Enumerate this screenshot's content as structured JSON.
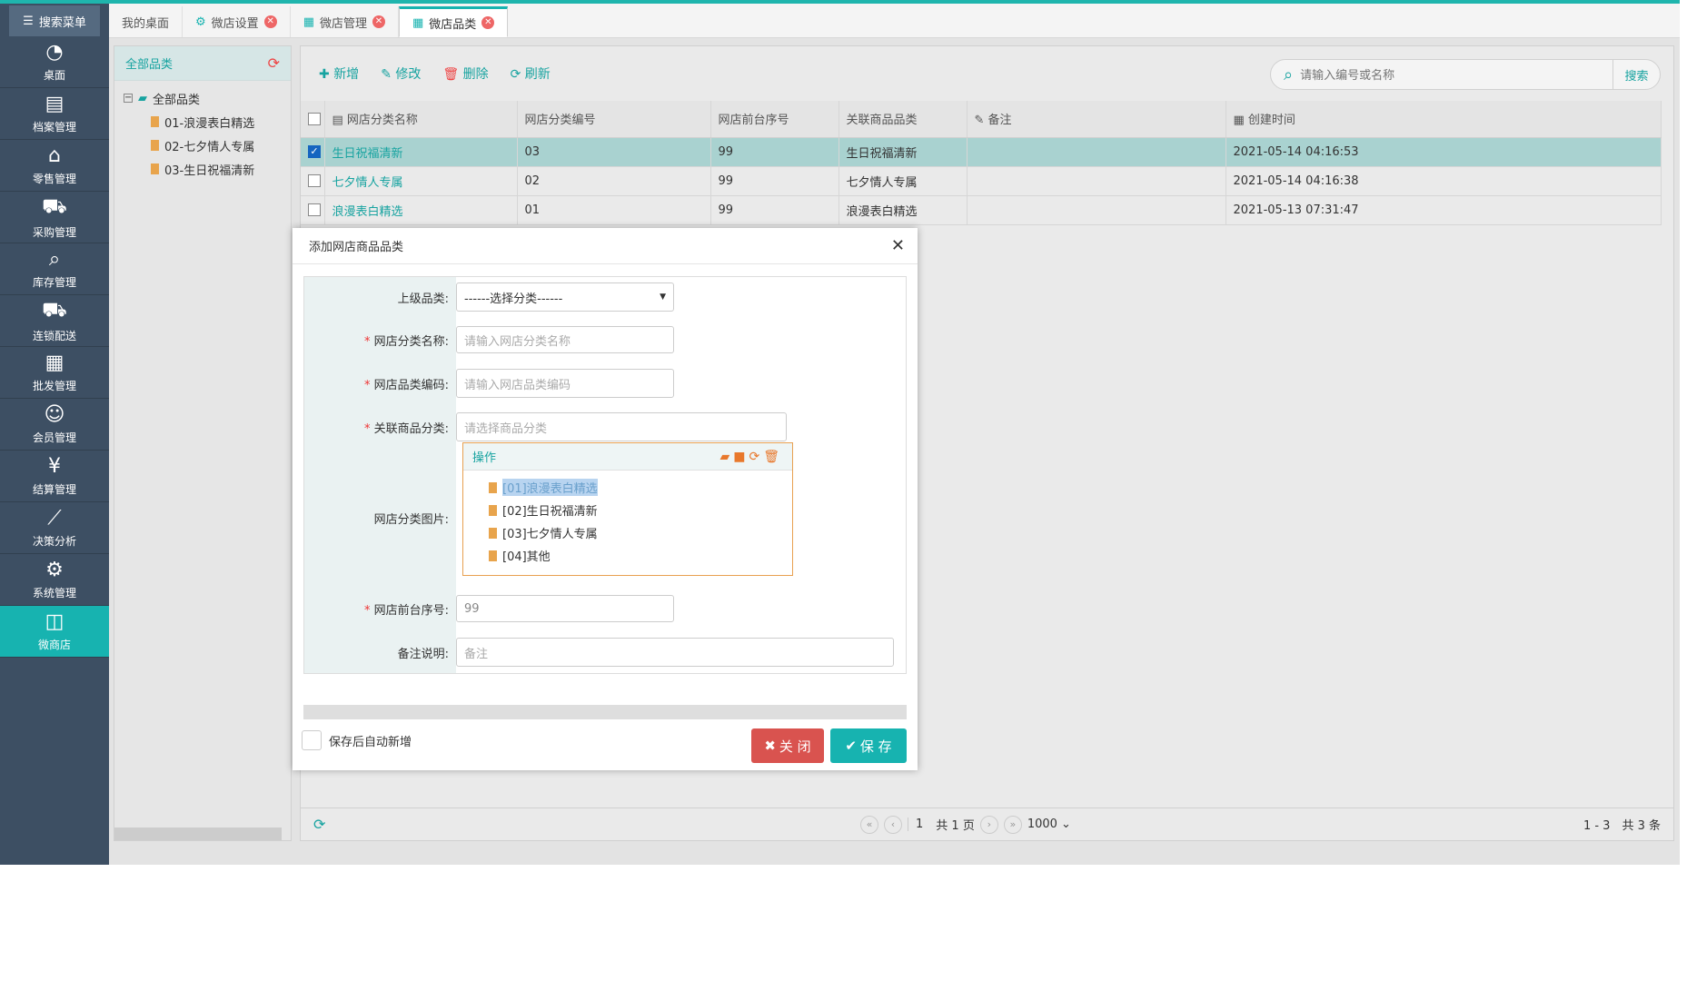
{
  "sidebar": {
    "search_label": "搜索菜单",
    "items": [
      {
        "label": "桌面",
        "icon": "dashboard-icon"
      },
      {
        "label": "档案管理",
        "icon": "archive-icon"
      },
      {
        "label": "零售管理",
        "icon": "store-icon"
      },
      {
        "label": "采购管理",
        "icon": "cart-icon"
      },
      {
        "label": "库存管理",
        "icon": "inventory-icon"
      },
      {
        "label": "连锁配送",
        "icon": "truck-icon"
      },
      {
        "label": "批发管理",
        "icon": "wholesale-icon"
      },
      {
        "label": "会员管理",
        "icon": "member-icon"
      },
      {
        "label": "结算管理",
        "icon": "settlement-icon"
      },
      {
        "label": "决策分析",
        "icon": "analysis-icon"
      },
      {
        "label": "系统管理",
        "icon": "gear-icon"
      },
      {
        "label": "微商店",
        "icon": "shop-bag-icon"
      }
    ]
  },
  "tabs": [
    {
      "label": "我的桌面"
    },
    {
      "label": "微店设置"
    },
    {
      "label": "微店管理"
    },
    {
      "label": "微店品类"
    }
  ],
  "left_panel": {
    "title": "全部品类",
    "root": "全部品类",
    "children": [
      "01-浪漫表白精选",
      "02-七夕情人专属",
      "03-生日祝福清新"
    ]
  },
  "toolbar": {
    "add": "新增",
    "edit": "修改",
    "delete": "删除",
    "refresh": "刷新",
    "search_placeholder": "请输入编号或名称",
    "search_btn": "搜索"
  },
  "table": {
    "headers": [
      "网店分类名称",
      "网店分类编号",
      "网店前台序号",
      "关联商品品类",
      "备注",
      "创建时间"
    ],
    "rows": [
      {
        "name": "生日祝福清新",
        "code": "03",
        "seq": "99",
        "cat": "生日祝福清新",
        "note": "",
        "time": "2021-05-14 04:16:53"
      },
      {
        "name": "七夕情人专属",
        "code": "02",
        "seq": "99",
        "cat": "七夕情人专属",
        "note": "",
        "time": "2021-05-14 04:16:38"
      },
      {
        "name": "浪漫表白精选",
        "code": "01",
        "seq": "99",
        "cat": "浪漫表白精选",
        "note": "",
        "time": "2021-05-13 07:31:47"
      }
    ]
  },
  "pager": {
    "page": "1",
    "total_pages": "共 1 页",
    "page_size": "1000",
    "summary": "1 - 3　共 3 条"
  },
  "dialog": {
    "title": "添加网店商品品类",
    "parent_label": "上级品类:",
    "parent_value": "------选择分类------",
    "name_label": "网店分类名称:",
    "name_placeholder": "请输入网店分类名称",
    "code_label": "网店品类编码:",
    "code_placeholder": "请输入网店品类编码",
    "cat_label": "关联商品分类:",
    "cat_placeholder": "请选择商品分类",
    "image_label": "网店分类图片:",
    "seq_label": "网店前台序号:",
    "seq_value": "99",
    "note_label": "备注说明:",
    "note_placeholder": "备注",
    "dropdown_header": "操作",
    "dropdown_items": [
      "[01]浪漫表白精选",
      "[02]生日祝福清新",
      "[03]七夕情人专属",
      "[04]其他"
    ],
    "auto_new_label": "保存后自动新增",
    "close_btn": "关 闭",
    "save_btn": "保 存"
  }
}
